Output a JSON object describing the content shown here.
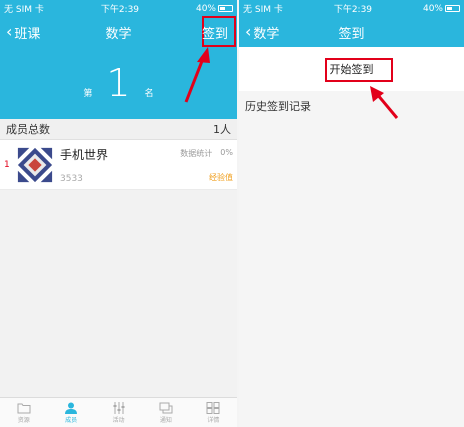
{
  "left": {
    "status": {
      "carrier": "无 SIM 卡",
      "time": "下午2:39",
      "battery": "40%"
    },
    "nav": {
      "back": "班课",
      "title": "数学",
      "action": "签到"
    },
    "rank": {
      "prefix": "第",
      "number": "1",
      "suffix": "名"
    },
    "members": {
      "label": "成员总数",
      "count": "1人"
    },
    "member_list": [
      {
        "index": "1",
        "name": "手机世界",
        "score": "3533",
        "stat1": "数据统计",
        "stat2": "0%",
        "badge": "经验值"
      }
    ],
    "tabs": [
      {
        "label": "资源",
        "icon": "folder-icon"
      },
      {
        "label": "成员",
        "icon": "person-icon"
      },
      {
        "label": "活动",
        "icon": "sliders-icon"
      },
      {
        "label": "通知",
        "icon": "chat-icon"
      },
      {
        "label": "详情",
        "icon": "grid-icon"
      }
    ]
  },
  "right": {
    "status": {
      "carrier": "无 SIM 卡",
      "time": "下午2:39",
      "battery": "40%"
    },
    "nav": {
      "back": "数学",
      "title": "签到"
    },
    "start_label": "开始签到",
    "history_label": "历史签到记录"
  },
  "colors": {
    "primary": "#2ab6dd",
    "annotation": "#e2001a",
    "rank_index": "#e2001a",
    "badge": "#f0a020"
  }
}
